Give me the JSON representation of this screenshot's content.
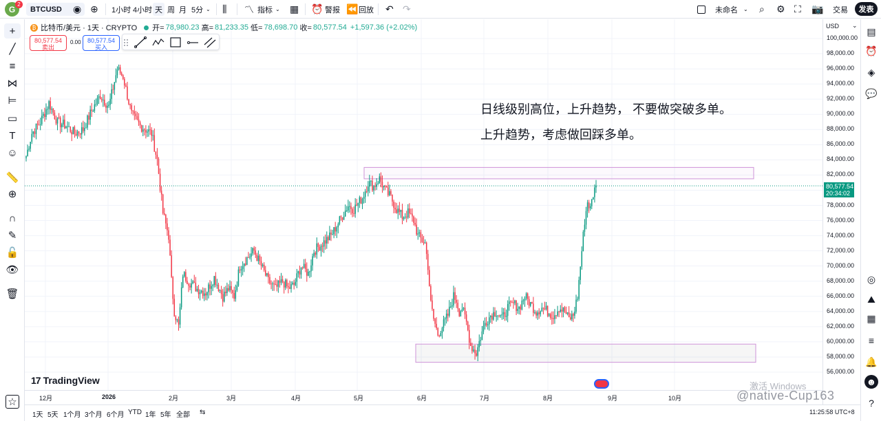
{
  "topbar": {
    "avatar_letter": "G",
    "notification_count": "2",
    "symbol": "BTCUSD",
    "intervals": [
      "1小时",
      "4小时",
      "天",
      "周",
      "月",
      "5分"
    ],
    "indicators_label": "指标",
    "alert_label": "警报",
    "replay_label": "回放",
    "layout_name": "未命名",
    "trade_label": "交易",
    "publish_label": "发表"
  },
  "legend": {
    "title": "比特币/美元 · 1天 · CRYPTO",
    "open_label": "开=",
    "open": "78,980.23",
    "high_label": "高=",
    "high": "81,233.35",
    "low_label": "低=",
    "low": "78,698.70",
    "close_label": "收=",
    "close": "80,577.54",
    "change": "+1,597.36 (+2.02%)"
  },
  "trade_buttons": {
    "sell_price": "80,577.54",
    "sell_label": "卖出",
    "spread": "0.00",
    "buy_price": "80,577.54",
    "buy_label": "买入"
  },
  "price_scale": {
    "currency": "USD",
    "labels": [
      "100,000.00",
      "98,000.00",
      "96,000.00",
      "94,000.00",
      "92,000.00",
      "90,000.00",
      "88,000.00",
      "86,000.00",
      "84,000.00",
      "82,000.00",
      "78,000.00",
      "76,000.00",
      "74,000.00",
      "72,000.00",
      "70,000.00",
      "68,000.00",
      "66,000.00",
      "64,000.00",
      "62,000.00",
      "60,000.00",
      "58,000.00",
      "56,000.00"
    ],
    "current_price": "80,577.54",
    "countdown": "20:34:02"
  },
  "time_scale": {
    "labels": [
      "12月",
      "2026",
      "2月",
      "3月",
      "4月",
      "5月",
      "6月",
      "7月",
      "8月",
      "9月",
      "10月"
    ]
  },
  "annotations": {
    "line1": "日线级别高位，上升趋势， 不要做突破多单。",
    "line2": "上升趋势，考虑做回踩多单。"
  },
  "branding": {
    "logo_text": "TradingView"
  },
  "bottom": {
    "ranges": [
      "1天",
      "5天",
      "1个月",
      "3个月",
      "6个月",
      "YTD",
      "1年",
      "5年",
      "全部"
    ],
    "clock": "11:25:58 UTC+8"
  },
  "overlay": {
    "watermark": "激活 Windows",
    "weibo": "@native-Cup163"
  },
  "chart_data": {
    "type": "candlestick",
    "symbol": "BTCUSD",
    "interval": "1D",
    "ylim": [
      56000,
      100000
    ],
    "current_price": 80577.54,
    "colors": {
      "up": "#089981",
      "down": "#f23645",
      "zone": "#ce93d8"
    },
    "zones": [
      {
        "from": 81500,
        "to": 83000,
        "start_label": "5月",
        "extends": "right"
      },
      {
        "from": 57300,
        "to": 59700,
        "start_label": "6月",
        "extends": "right"
      }
    ],
    "path_closes": [
      [
        0,
        84500
      ],
      [
        4,
        87500
      ],
      [
        10,
        89000
      ],
      [
        16,
        91500
      ],
      [
        22,
        89000
      ],
      [
        28,
        88500
      ],
      [
        34,
        87500
      ],
      [
        40,
        88000
      ],
      [
        46,
        90500
      ],
      [
        52,
        92500
      ],
      [
        58,
        91000
      ],
      [
        64,
        96000
      ],
      [
        68,
        95000
      ],
      [
        74,
        90000
      ],
      [
        80,
        88500
      ],
      [
        84,
        88000
      ],
      [
        88,
        87500
      ],
      [
        92,
        84000
      ],
      [
        96,
        77000
      ],
      [
        100,
        74000
      ],
      [
        102,
        68000
      ],
      [
        104,
        64000
      ],
      [
        107,
        62000
      ],
      [
        110,
        69000
      ],
      [
        114,
        68000
      ],
      [
        120,
        67000
      ],
      [
        126,
        66500
      ],
      [
        132,
        68500
      ],
      [
        138,
        66000
      ],
      [
        142,
        67000
      ],
      [
        146,
        66000
      ],
      [
        150,
        70000
      ],
      [
        155,
        71000
      ],
      [
        160,
        72000
      ],
      [
        165,
        70000
      ],
      [
        170,
        68000
      ],
      [
        175,
        67000
      ],
      [
        180,
        68000
      ],
      [
        184,
        67000
      ],
      [
        188,
        67500
      ],
      [
        193,
        70000
      ],
      [
        198,
        69000
      ],
      [
        202,
        72000
      ],
      [
        208,
        73000
      ],
      [
        214,
        74000
      ],
      [
        220,
        76000
      ],
      [
        226,
        78000
      ],
      [
        230,
        77500
      ],
      [
        236,
        79000
      ],
      [
        240,
        81000
      ],
      [
        244,
        80500
      ],
      [
        248,
        81500
      ],
      [
        252,
        80000
      ],
      [
        256,
        79000
      ],
      [
        260,
        77500
      ],
      [
        264,
        76500
      ],
      [
        268,
        77000
      ],
      [
        272,
        76000
      ],
      [
        275,
        74000
      ],
      [
        280,
        73000
      ],
      [
        282,
        70000
      ],
      [
        284,
        65000
      ],
      [
        286,
        63000
      ],
      [
        289,
        61000
      ],
      [
        292,
        62000
      ],
      [
        296,
        63500
      ],
      [
        300,
        66000
      ],
      [
        302,
        65500
      ],
      [
        304,
        64000
      ],
      [
        306,
        64500
      ],
      [
        309,
        62500
      ],
      [
        312,
        59500
      ],
      [
        316,
        58500
      ],
      [
        318,
        60000
      ],
      [
        322,
        62500
      ],
      [
        326,
        63500
      ],
      [
        330,
        64000
      ],
      [
        334,
        63000
      ],
      [
        338,
        64500
      ],
      [
        342,
        65000
      ],
      [
        346,
        64500
      ],
      [
        350,
        66000
      ],
      [
        354,
        65000
      ],
      [
        358,
        64000
      ],
      [
        362,
        64500
      ],
      [
        366,
        64000
      ],
      [
        370,
        63500
      ],
      [
        374,
        64500
      ],
      [
        378,
        64000
      ],
      [
        381,
        63000
      ],
      [
        384,
        63500
      ],
      [
        387,
        66000
      ],
      [
        390,
        72000
      ],
      [
        392,
        76000
      ],
      [
        394,
        78500
      ],
      [
        396,
        77500
      ],
      [
        398,
        79500
      ],
      [
        400,
        80577
      ]
    ]
  }
}
